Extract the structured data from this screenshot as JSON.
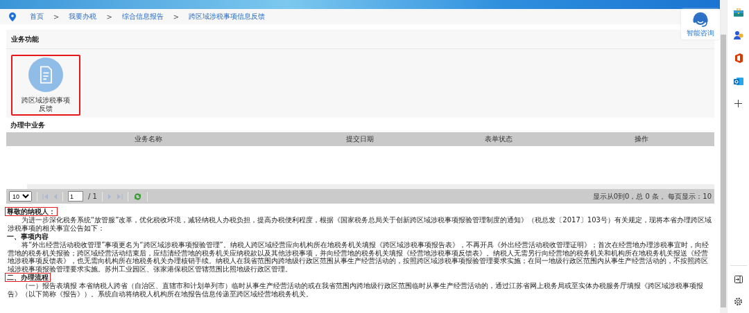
{
  "breadcrumb": [
    {
      "label": "首页"
    },
    {
      "label": "我要办税"
    },
    {
      "label": "综合信息报告"
    },
    {
      "label": "跨区域涉税事项信息反馈"
    }
  ],
  "separator": ">",
  "assistant": {
    "label": "智能咨询"
  },
  "functions": {
    "title": "业务功能",
    "items": [
      {
        "label": "跨区域涉税事项反馈",
        "highlighted": true
      }
    ]
  },
  "table": {
    "title": "办理中业务",
    "columns": [
      "业务名称",
      "提交日期",
      "表单状态",
      "操作"
    ]
  },
  "pager": {
    "page_size": "10",
    "page": "1",
    "total_pages": "/ 1",
    "summary": "显示从0到0，总 0 条 。每页显示：10"
  },
  "notice": [
    {
      "kind": "heading",
      "text": "尊敬的纳税人：",
      "highlighted": true
    },
    {
      "kind": "paragraph",
      "text": "为进一步深化税务系统“放管服”改革，优化税收环境，减轻纳税人办税负担，提高办税便利程度，根据《国家税务总局关于创新跨区域涉税事项报验管理制度的通知》（税总发〔2017〕103号）有关规定，现将本省办理跨区域涉税事项的相关事宜公告如下："
    },
    {
      "kind": "heading",
      "text": "一、事项内容",
      "highlighted": false
    },
    {
      "kind": "paragraph",
      "text": "将“外出经营活动税收管理”事项更名为“跨区域涉税事项报验管理”。纳税人跨区域经营应向机构所在地税务机关填报《跨区域涉税事项报告表》，不再开具《外出经营活动税收管理证明》；首次在经营地办理涉税事宜时，向经营地的税务机关报验；跨区域经营活动结束后，应结清经营地的税务机关应纳税款以及其他涉税事项，并向经营地的税务机关填报《经营地涉税事项反馈表》。纳税人无需另行向经营地的税务机关和机构所在地税务机关报送《经营地涉税事项反馈表》，也无需向机构所在地税务机关办理核销手续。纳税人在我省范围内跨地级行政区范围从事生产经营活动的，按照跨区域涉税事项报验管理要求实施；在同一地级行政区范围内从事生产经营活动的，不按照跨区域涉税事项报验管理要求实施。苏州工业园区、张家港保税区管辖范围比照地级行政区管理。"
    },
    {
      "kind": "heading",
      "text": "二、办理流程",
      "highlighted": true
    },
    {
      "kind": "paragraph",
      "text": "（一）报告表填报 本省纳税人跨省（自治区、直辖市和计划单列市）临时从事生产经营活动的或在我省范围内跨地级行政区范围临时从事生产经营活动的，通过江苏省网上税务局或至实体办税服务厅填报《跨区域涉税事项报告》（以下简称《报告》）。系统自动将纳税人机构所在地报告信息传递至跨区域经营地税务机关。"
    }
  ]
}
